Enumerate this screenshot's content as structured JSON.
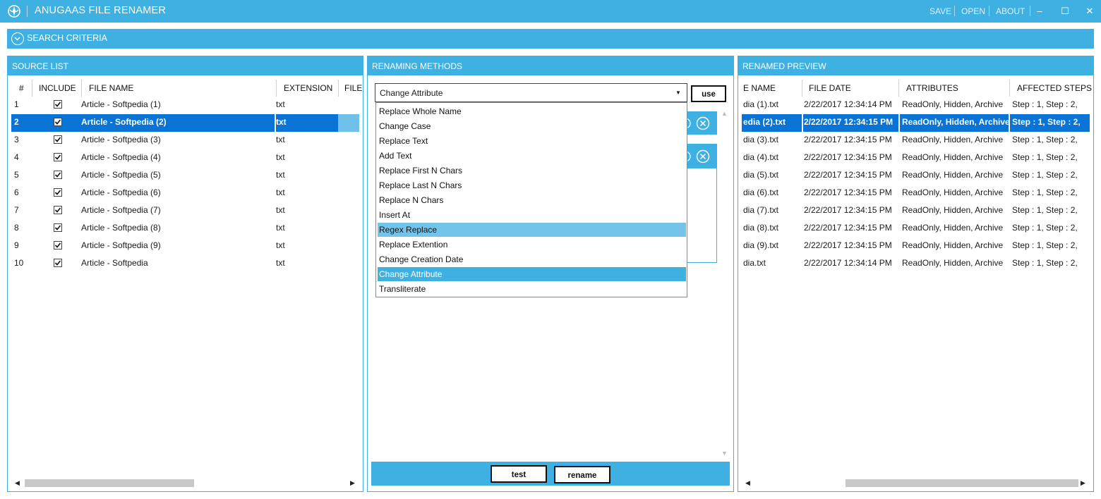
{
  "window": {
    "title": "ANUGAAS FILE RENAMER",
    "menu": [
      "SAVE",
      "OPEN",
      "ABOUT"
    ],
    "controls": {
      "minimize": "–",
      "maximize": "☐",
      "close": "✕"
    },
    "accent_color": "#3eb0e2",
    "selection_color": "#0a74d6"
  },
  "search": {
    "label": "SEARCH CRITERIA"
  },
  "source": {
    "title": "SOURCE LIST",
    "columns": [
      "#",
      "INCLUDE",
      "FILE NAME",
      "EXTENSION",
      "FILE"
    ],
    "rows": [
      {
        "num": "1",
        "name": "Article - Softpedia (1)",
        "ext": "txt"
      },
      {
        "num": "2",
        "name": "Article - Softpedia (2)",
        "ext": "txt"
      },
      {
        "num": "3",
        "name": "Article - Softpedia (3)",
        "ext": "txt"
      },
      {
        "num": "4",
        "name": "Article - Softpedia (4)",
        "ext": "txt"
      },
      {
        "num": "5",
        "name": "Article - Softpedia (5)",
        "ext": "txt"
      },
      {
        "num": "6",
        "name": "Article - Softpedia (6)",
        "ext": "txt"
      },
      {
        "num": "7",
        "name": "Article - Softpedia (7)",
        "ext": "txt"
      },
      {
        "num": "8",
        "name": "Article - Softpedia (8)",
        "ext": "txt"
      },
      {
        "num": "9",
        "name": "Article - Softpedia (9)",
        "ext": "txt"
      },
      {
        "num": "10",
        "name": "Article - Softpedia",
        "ext": "txt"
      }
    ]
  },
  "methods": {
    "title": "RENAMING METHODS",
    "selected": "Change Attribute",
    "use_label": "use",
    "options": [
      "Replace Whole Name",
      "Change Case",
      "Replace Text",
      "Add Text",
      "Replace First N Chars",
      "Replace Last N Chars",
      "Replace N Chars",
      "Insert At",
      "Regex Replace",
      "Replace Extention",
      "Change Creation Date",
      "Change Attribute",
      "Transliterate"
    ],
    "test_label": "test",
    "rename_label": "rename"
  },
  "preview": {
    "title": "RENAMED PREVIEW",
    "columns": [
      "E NAME",
      "FILE DATE",
      "ATTRIBUTES",
      "AFFECTED STEPS"
    ],
    "rows": [
      {
        "name": "dia (1).txt",
        "date": "2/22/2017 12:34:14 PM",
        "attr": "ReadOnly, Hidden, Archive",
        "steps": "Step : 1, Step : 2,"
      },
      {
        "name": "edia (2).txt",
        "date": "2/22/2017 12:34:15 PM",
        "attr": "ReadOnly, Hidden, Archive",
        "steps": "Step : 1, Step : 2,"
      },
      {
        "name": "dia (3).txt",
        "date": "2/22/2017 12:34:15 PM",
        "attr": "ReadOnly, Hidden, Archive",
        "steps": "Step : 1, Step : 2,"
      },
      {
        "name": "dia (4).txt",
        "date": "2/22/2017 12:34:15 PM",
        "attr": "ReadOnly, Hidden, Archive",
        "steps": "Step : 1, Step : 2,"
      },
      {
        "name": "dia (5).txt",
        "date": "2/22/2017 12:34:15 PM",
        "attr": "ReadOnly, Hidden, Archive",
        "steps": "Step : 1, Step : 2,"
      },
      {
        "name": "dia (6).txt",
        "date": "2/22/2017 12:34:15 PM",
        "attr": "ReadOnly, Hidden, Archive",
        "steps": "Step : 1, Step : 2,"
      },
      {
        "name": "dia (7).txt",
        "date": "2/22/2017 12:34:15 PM",
        "attr": "ReadOnly, Hidden, Archive",
        "steps": "Step : 1, Step : 2,"
      },
      {
        "name": "dia (8).txt",
        "date": "2/22/2017 12:34:15 PM",
        "attr": "ReadOnly, Hidden, Archive",
        "steps": "Step : 1, Step : 2,"
      },
      {
        "name": "dia (9).txt",
        "date": "2/22/2017 12:34:15 PM",
        "attr": "ReadOnly, Hidden, Archive",
        "steps": "Step : 1, Step : 2,"
      },
      {
        "name": "dia.txt",
        "date": "2/22/2017 12:34:14 PM",
        "attr": "ReadOnly, Hidden, Archive",
        "steps": "Step : 1, Step : 2,"
      }
    ]
  }
}
